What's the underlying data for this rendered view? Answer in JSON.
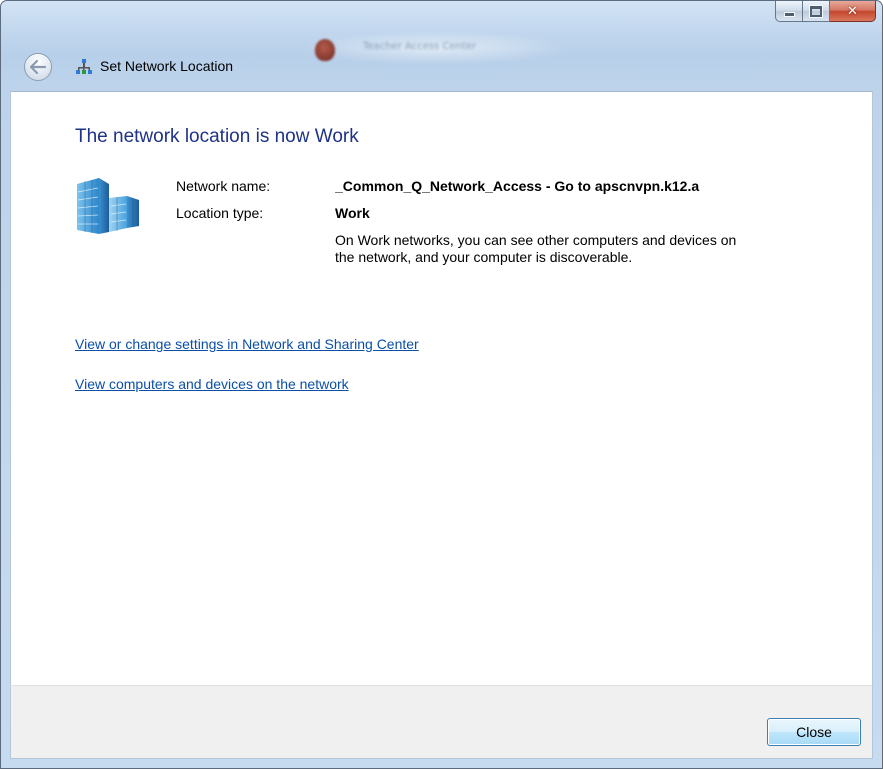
{
  "window": {
    "title": "Set Network Location",
    "caption_buttons": {
      "minimize": "minimize-icon",
      "maximize": "maximize-icon",
      "close": "close-icon"
    }
  },
  "content": {
    "heading": "The network location is now Work",
    "network_name_label": "Network name:",
    "network_name_value": "_Common_Q_Network_Access - Go to apscnvpn.k12.a",
    "location_type_label": "Location type:",
    "location_type_value": "Work",
    "description": "On Work networks, you can see other computers and devices on the network, and your computer is discoverable.",
    "links": [
      "View or change settings in Network and Sharing Center",
      "View computers and devices on the network"
    ]
  },
  "footer": {
    "close_label": "Close"
  },
  "colors": {
    "heading": "#1e3287",
    "link": "#0b4fa8",
    "close_button_accent": "#c4462c"
  }
}
